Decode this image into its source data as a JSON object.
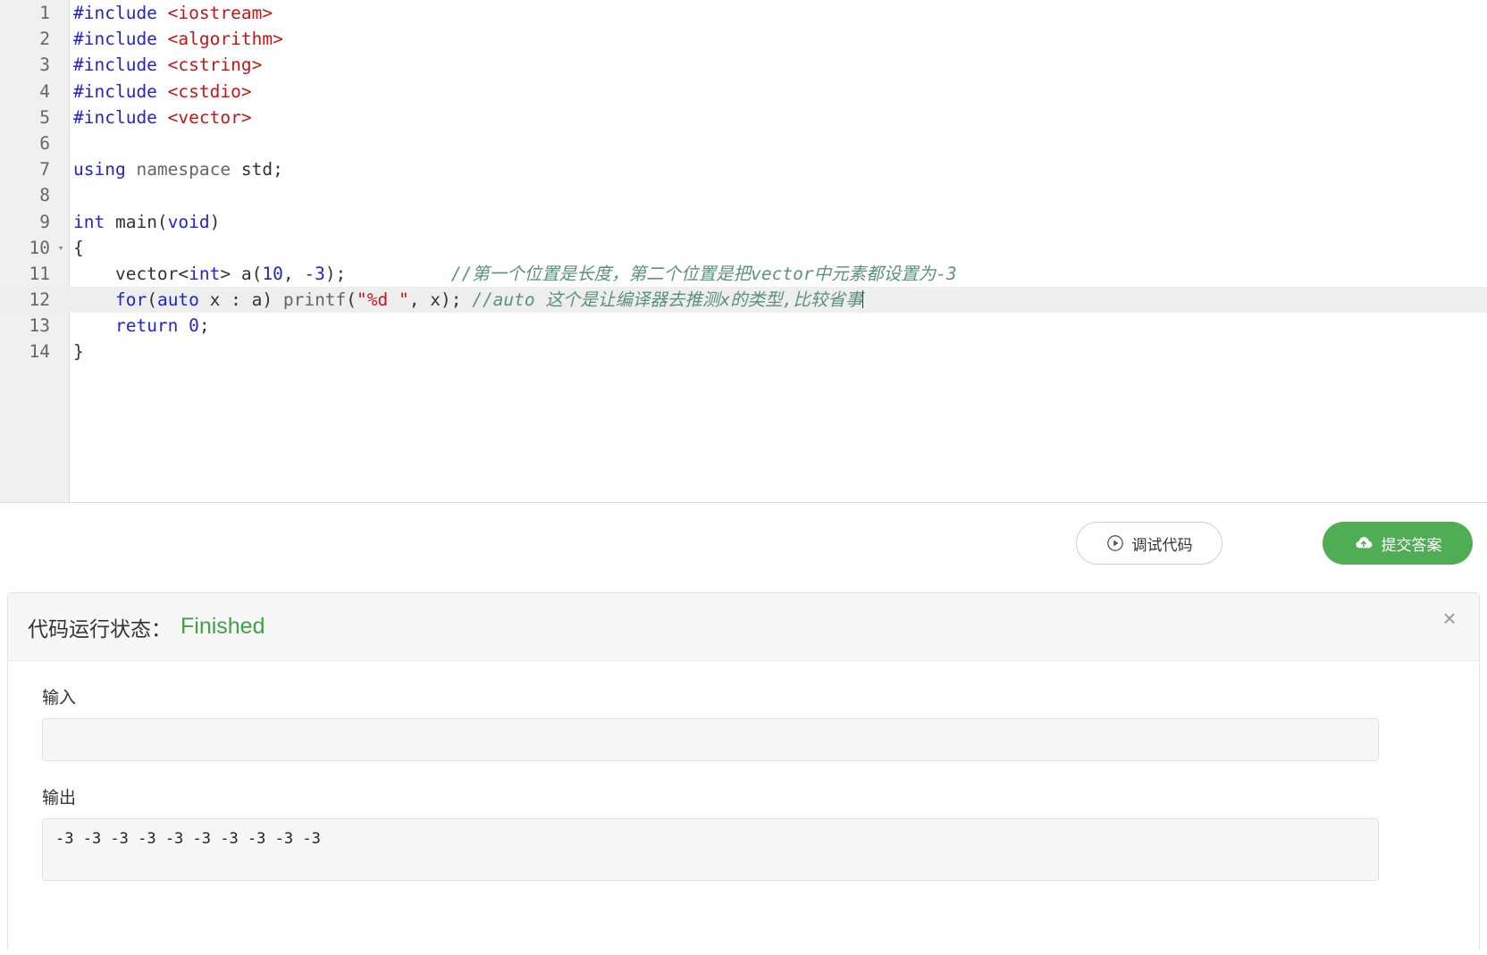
{
  "editor": {
    "lines": [
      {
        "num": "1",
        "fold": "",
        "tokens": [
          {
            "t": "#include ",
            "c": "tok-pre"
          },
          {
            "t": "<iostream>",
            "c": "tok-inc"
          }
        ]
      },
      {
        "num": "2",
        "fold": "",
        "tokens": [
          {
            "t": "#include ",
            "c": "tok-pre"
          },
          {
            "t": "<algorithm>",
            "c": "tok-inc"
          }
        ]
      },
      {
        "num": "3",
        "fold": "",
        "tokens": [
          {
            "t": "#include ",
            "c": "tok-pre"
          },
          {
            "t": "<cstring>",
            "c": "tok-inc"
          }
        ]
      },
      {
        "num": "4",
        "fold": "",
        "tokens": [
          {
            "t": "#include ",
            "c": "tok-pre"
          },
          {
            "t": "<cstdio>",
            "c": "tok-inc"
          }
        ]
      },
      {
        "num": "5",
        "fold": "",
        "tokens": [
          {
            "t": "#include ",
            "c": "tok-pre"
          },
          {
            "t": "<vector>",
            "c": "tok-inc"
          }
        ]
      },
      {
        "num": "6",
        "fold": "",
        "tokens": []
      },
      {
        "num": "7",
        "fold": "",
        "tokens": [
          {
            "t": "using ",
            "c": "tok-kw"
          },
          {
            "t": "namespace ",
            "c": "tok-ident"
          },
          {
            "t": "std;",
            "c": "tok-plain"
          }
        ]
      },
      {
        "num": "8",
        "fold": "",
        "tokens": []
      },
      {
        "num": "9",
        "fold": "",
        "tokens": [
          {
            "t": "int ",
            "c": "tok-type"
          },
          {
            "t": "main(",
            "c": "tok-plain"
          },
          {
            "t": "void",
            "c": "tok-type"
          },
          {
            "t": ")",
            "c": "tok-plain"
          }
        ]
      },
      {
        "num": "10",
        "fold": "▾",
        "tokens": [
          {
            "t": "{",
            "c": "tok-plain"
          }
        ]
      },
      {
        "num": "11",
        "fold": "",
        "tokens": [
          {
            "t": "    vector",
            "c": "tok-plain"
          },
          {
            "t": "<",
            "c": "tok-plain"
          },
          {
            "t": "int",
            "c": "tok-type"
          },
          {
            "t": "> a(",
            "c": "tok-plain"
          },
          {
            "t": "10",
            "c": "tok-num"
          },
          {
            "t": ", ",
            "c": "tok-plain"
          },
          {
            "t": "-3",
            "c": "tok-num"
          },
          {
            "t": ");          ",
            "c": "tok-plain"
          },
          {
            "t": "//第一个位置是长度，第二个位置是把vector中元素都设置为-3",
            "c": "tok-cmt"
          }
        ]
      },
      {
        "num": "12",
        "fold": "",
        "active": true,
        "tokens": [
          {
            "t": "    ",
            "c": "tok-plain"
          },
          {
            "t": "for",
            "c": "tok-kw"
          },
          {
            "t": "(",
            "c": "tok-plain"
          },
          {
            "t": "auto",
            "c": "tok-kw"
          },
          {
            "t": " x : a) ",
            "c": "tok-plain"
          },
          {
            "t": "printf",
            "c": "tok-ident"
          },
          {
            "t": "(",
            "c": "tok-plain"
          },
          {
            "t": "\"%d \"",
            "c": "tok-str"
          },
          {
            "t": ", x); ",
            "c": "tok-plain"
          },
          {
            "t": "//auto 这个是让编译器去推测x的类型,比较省事",
            "c": "tok-cmt"
          }
        ]
      },
      {
        "num": "13",
        "fold": "",
        "tokens": [
          {
            "t": "    ",
            "c": "tok-plain"
          },
          {
            "t": "return ",
            "c": "tok-kw"
          },
          {
            "t": "0",
            "c": "tok-num"
          },
          {
            "t": ";",
            "c": "tok-plain"
          }
        ]
      },
      {
        "num": "14",
        "fold": "",
        "tokens": [
          {
            "t": "}",
            "c": "tok-plain"
          }
        ]
      }
    ]
  },
  "actions": {
    "debug_label": "调试代码",
    "debug_icon": "play-circle-icon",
    "submit_label": "提交答案",
    "submit_icon": "cloud-upload-icon",
    "submit_color": "#4fad54"
  },
  "result": {
    "status_label": "代码运行状态：",
    "status_value": "Finished",
    "status_color": "#42a047",
    "close_icon": "close-icon",
    "close_glyph": "×",
    "input_label": "输入",
    "input_value": "",
    "input_placeholder": "",
    "output_label": "输出",
    "output_value": "-3 -3 -3 -3 -3 -3 -3 -3 -3 -3"
  }
}
